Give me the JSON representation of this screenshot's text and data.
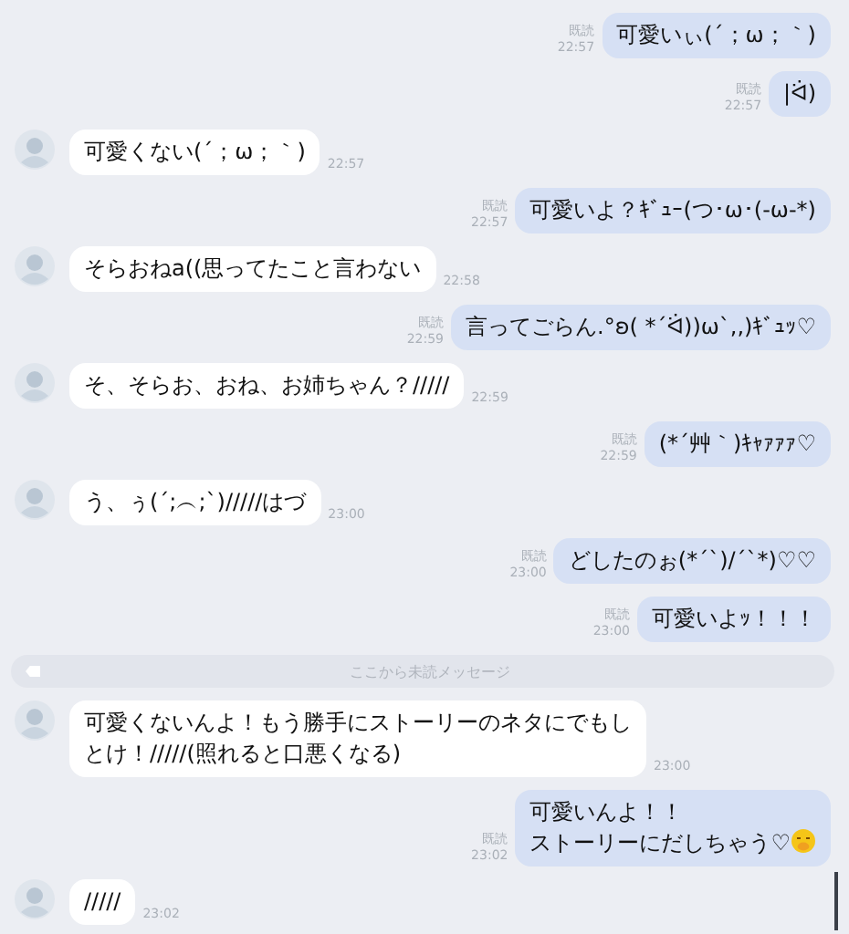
{
  "messages": [
    {
      "kind": "sent",
      "text": "可愛いぃ(´；ω；｀)",
      "read": "既読",
      "time": "22:57"
    },
    {
      "kind": "sent",
      "text": "|ᐛ)",
      "read": "既読",
      "time": "22:57"
    },
    {
      "kind": "received",
      "text": "可愛くない(´；ω；｀)",
      "time": "22:57"
    },
    {
      "kind": "sent",
      "text": "可愛いよ？ｷﾞｭｰ(つ･ω･(-ω-*)",
      "read": "既読",
      "time": "22:57"
    },
    {
      "kind": "received",
      "text": "そらおねa((思ってたこと言わない",
      "time": "22:58"
    },
    {
      "kind": "sent",
      "text": "言ってごらん.°ʚ( *´ᐛ))ω`,,)ｷﾞｭｯ♡",
      "read": "既読",
      "time": "22:59"
    },
    {
      "kind": "received",
      "text": "そ、そらお、おね、お姉ちゃん？/////",
      "time": "22:59"
    },
    {
      "kind": "sent",
      "text": "(*´艸｀)ｷｬｧｧｧ♡",
      "read": "既読",
      "time": "22:59"
    },
    {
      "kind": "received",
      "text": "う、ぅ(´;︵;`)/////はづ",
      "time": "23:00"
    },
    {
      "kind": "sent",
      "text": "どしたのぉ(*´`)/´`*)♡♡",
      "read": "既読",
      "time": "23:00"
    },
    {
      "kind": "sent",
      "text": "可愛いよｯ！！！",
      "read": "既読",
      "time": "23:00"
    },
    {
      "kind": "divider",
      "text": "ここから未読メッセージ"
    },
    {
      "kind": "received",
      "text": "可愛くないんよ！もう勝手にストーリーのネタにでもしとけ！/////(照れると口悪くなる)",
      "time": "23:00"
    },
    {
      "kind": "sent",
      "lines": [
        "可愛いんよ！！",
        "ストーリーにだしちゃう♡"
      ],
      "has_emoji": true,
      "read": "既読",
      "time": "23:02"
    },
    {
      "kind": "received",
      "text": "/////",
      "time": "23:02"
    }
  ]
}
